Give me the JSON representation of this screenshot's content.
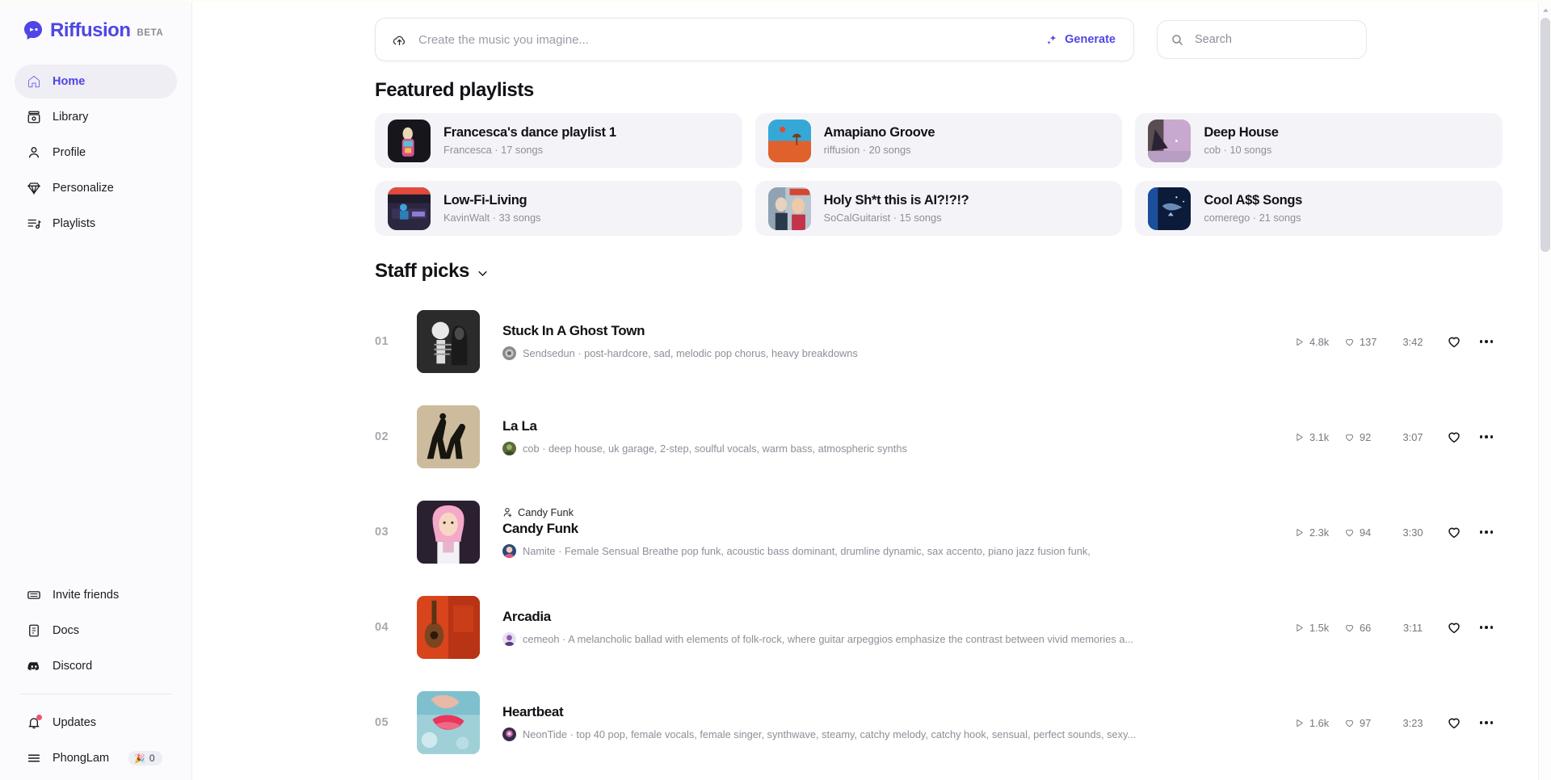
{
  "brand": {
    "name": "Riffusion",
    "tag": "BETA",
    "logo_icon": "riffusion-logo-icon",
    "accent": "#4f46e5"
  },
  "sidebar": {
    "primary": [
      {
        "label": "Home",
        "icon": "home-icon",
        "active": true
      },
      {
        "label": "Library",
        "icon": "library-icon",
        "active": false
      },
      {
        "label": "Profile",
        "icon": "profile-icon",
        "active": false
      },
      {
        "label": "Personalize",
        "icon": "gem-icon",
        "active": false
      },
      {
        "label": "Playlists",
        "icon": "playlist-icon",
        "active": false
      }
    ],
    "secondary": [
      {
        "label": "Invite friends",
        "icon": "ticket-icon"
      },
      {
        "label": "Docs",
        "icon": "document-icon"
      },
      {
        "label": "Discord",
        "icon": "discord-icon"
      }
    ],
    "updates": {
      "label": "Updates",
      "icon": "bell-icon",
      "has_badge": true,
      "badge_color": "#f0526d"
    },
    "user": {
      "label": "PhongLam",
      "icon": "menu-icon",
      "credits": "0",
      "credit_emoji": "party-popper-icon"
    }
  },
  "topbar": {
    "prompt": {
      "icon": "upload-cloud-icon",
      "value": "",
      "placeholder": "Create the music you imagine...",
      "generate_label": "Generate",
      "generate_icon": "sparkles-icon"
    },
    "search": {
      "icon": "search-icon",
      "value": "",
      "placeholder": "Search"
    }
  },
  "featured": {
    "title": "Featured playlists",
    "items": [
      {
        "title": "Francesca's dance playlist 1",
        "owner": "Francesca",
        "count": "17 songs",
        "art": "art-francesca"
      },
      {
        "title": "Amapiano Groove",
        "owner": "riffusion",
        "count": "20 songs",
        "art": "art-amapiano"
      },
      {
        "title": "Deep House",
        "owner": "cob",
        "count": "10 songs",
        "art": "art-deephouse"
      },
      {
        "title": "Low-Fi-Living",
        "owner": "KavinWalt",
        "count": "33 songs",
        "art": "art-lowfi"
      },
      {
        "title": "Holy Sh*t this is AI?!?!?",
        "owner": "SoCalGuitarist",
        "count": "15 songs",
        "art": "art-holy"
      },
      {
        "title": "Cool A$$ Songs",
        "owner": "comerego",
        "count": "21 songs",
        "art": "art-cool"
      }
    ]
  },
  "staff_picks": {
    "title": "Staff picks",
    "chevron_icon": "chevron-down-icon",
    "tracks": [
      {
        "num": "01",
        "title": "Stuck In A Ghost Town",
        "artist": "Sendsedun",
        "tags": "post-hardcore, sad, melodic pop chorus, heavy breakdowns",
        "plays": "4.8k",
        "likes": "137",
        "duration": "3:42",
        "art": "art-ghosttown",
        "collab": ""
      },
      {
        "num": "02",
        "title": "La La",
        "artist": "cob",
        "tags": "deep house, uk garage, 2-step, soulful vocals, warm bass, atmospheric synths",
        "plays": "3.1k",
        "likes": "92",
        "duration": "3:07",
        "art": "art-lala",
        "collab": ""
      },
      {
        "num": "03",
        "title": "Candy Funk",
        "artist": "Namite",
        "tags": "Female Sensual Breathe pop funk, acoustic bass dominant, drumline dynamic, sax accento, piano jazz fusion funk,",
        "plays": "2.3k",
        "likes": "94",
        "duration": "3:30",
        "art": "art-candyfunk",
        "collab": "Candy Funk"
      },
      {
        "num": "04",
        "title": "Arcadia",
        "artist": "cemeoh",
        "tags": "A melancholic ballad with elements of folk-rock, where guitar arpeggios emphasize the contrast between vivid memories a...",
        "plays": "1.5k",
        "likes": "66",
        "duration": "3:11",
        "art": "art-arcadia",
        "collab": ""
      },
      {
        "num": "05",
        "title": "Heartbeat",
        "artist": "NeonTide",
        "tags": "top 40 pop, female vocals, female singer, synthwave, steamy, catchy melody, catchy hook, sensual, perfect sounds, sexy...",
        "plays": "1.6k",
        "likes": "97",
        "duration": "3:23",
        "art": "art-heartbeat",
        "collab": ""
      }
    ],
    "separator": "·",
    "icons": {
      "play": "play-icon",
      "like": "heart-icon",
      "favorite": "heart-outline-icon",
      "more": "more-options-icon"
    }
  }
}
